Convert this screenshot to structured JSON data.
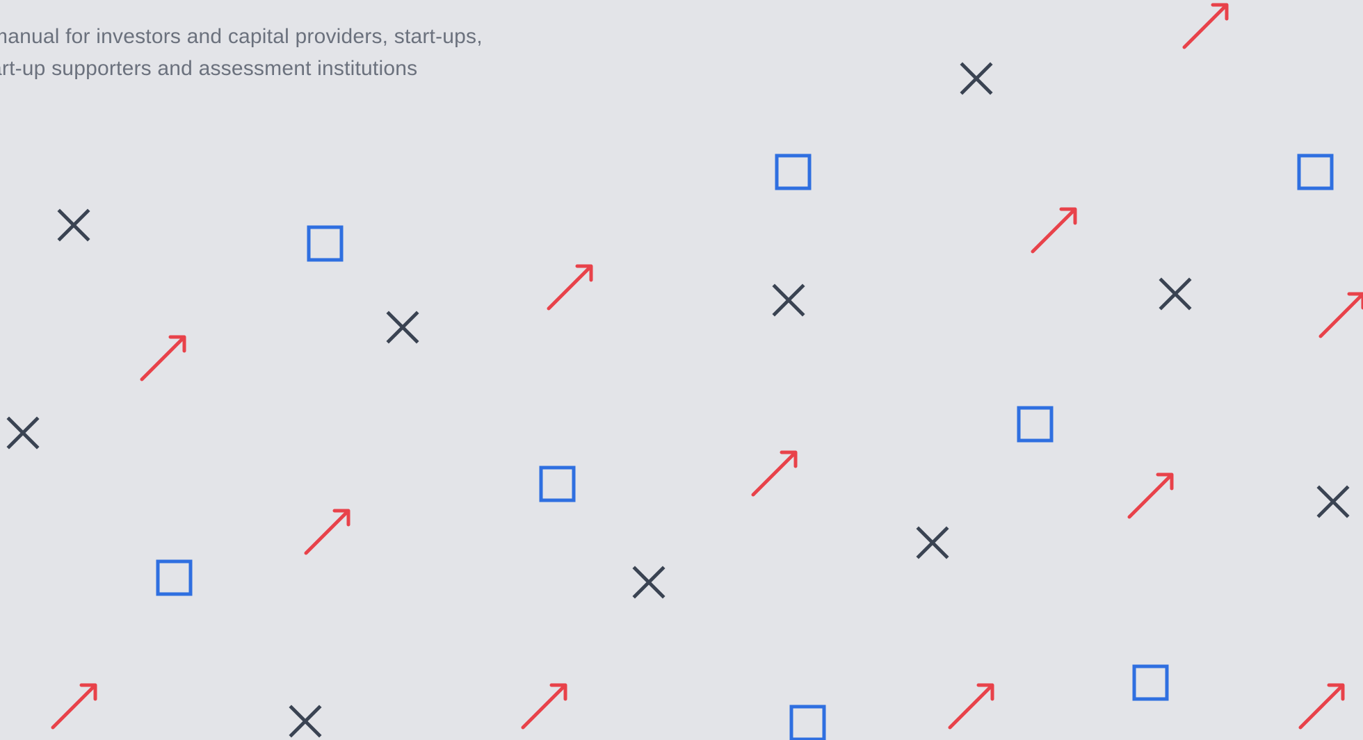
{
  "intro": {
    "line1": "manual for investors and capital providers, start-ups,",
    "line2": "art-up supporters and assessment institutions"
  },
  "pattern": {
    "background_color": "#e3e4e8",
    "cross_color": "#3a4352",
    "square_color": "#2f6fe0",
    "arrow_color": "#e8424a",
    "shapes": [
      "cross-icon",
      "square-icon",
      "arrow-up-right-icon"
    ]
  }
}
